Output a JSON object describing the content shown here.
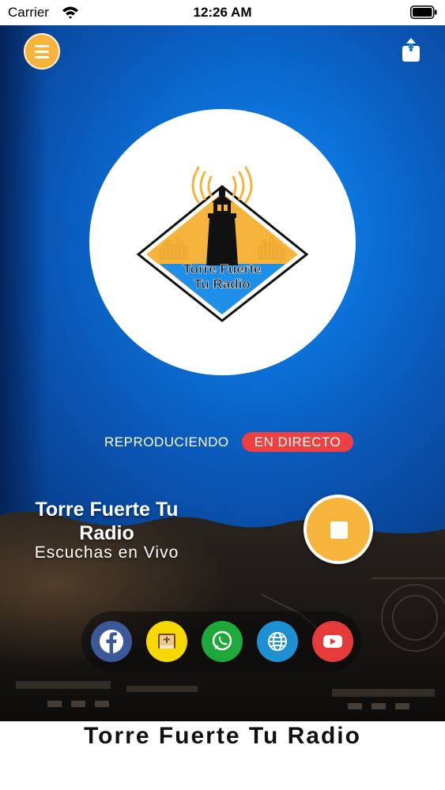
{
  "status_bar": {
    "carrier": "Carrier",
    "time": "12:26 AM",
    "icons": [
      "wifi-icon",
      "battery-icon"
    ]
  },
  "header": {
    "menu_icon": "hamburger-menu-icon",
    "share_icon": "share-icon"
  },
  "logo": {
    "text_line1": "Torre Fuerte",
    "text_line2": "Tu Radio"
  },
  "player": {
    "status_label": "REPRODUCIENDO",
    "live_badge": "EN DIRECTO",
    "station_name": "Torre Fuerte Tu Radio",
    "subtitle": "Escuchas en Vivo",
    "control_icon": "stop-icon"
  },
  "social": [
    {
      "name": "facebook",
      "icon": "facebook-icon",
      "color": "#3b5998"
    },
    {
      "name": "bible",
      "icon": "bible-icon",
      "color": "#f5d800"
    },
    {
      "name": "whatsapp",
      "icon": "whatsapp-icon",
      "color": "#1fa83a"
    },
    {
      "name": "website",
      "icon": "globe-icon",
      "color": "#1e8fd0"
    },
    {
      "name": "youtube",
      "icon": "youtube-icon",
      "color": "#e53b3b"
    }
  ],
  "footer": {
    "title": "Torre Fuerte Tu Radio"
  },
  "colors": {
    "accent": "#f6b43d",
    "live": "#ee4040",
    "background_blue": "#0b6fd6"
  }
}
